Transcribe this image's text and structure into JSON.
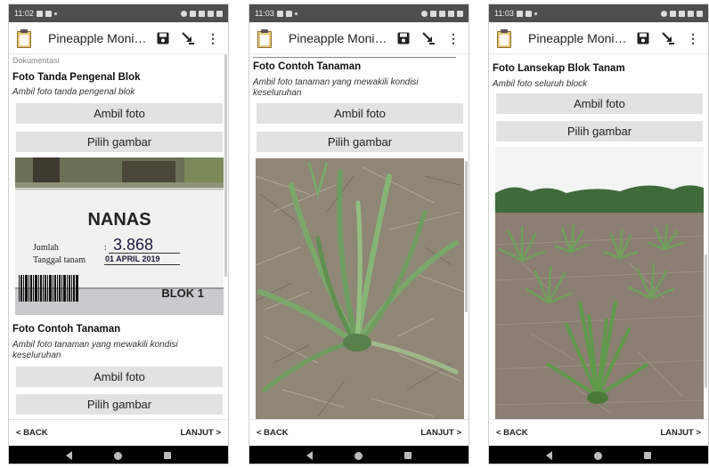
{
  "app": {
    "title": "Pineapple Monito...",
    "icons": {
      "app": "clipboard-icon",
      "save": "save-icon",
      "goto": "jump-arrow-icon",
      "menu": "overflow-menu-icon"
    },
    "accent": "#e2e2e2"
  },
  "screens": [
    {
      "status_time": "11:02",
      "section": "Dokumentasi",
      "questions": [
        {
          "title": "Foto Tanda Pengenal Blok",
          "hint": "Ambil foto tanda pengenal blok",
          "take_photo": "Ambil foto",
          "choose_image": "Pilih gambar",
          "sign": {
            "heading": "NANAS",
            "row1_label": "Jumlah",
            "row1_value": "3.868",
            "row2_label": "Tanggal tanam",
            "row2_value": "01 APRIL 2019",
            "block": "BLOK 1"
          }
        },
        {
          "title": "Foto Contoh Tanaman",
          "hint": "Ambil foto tanaman yang mewakili kondisi keseluruhan",
          "take_photo": "Ambil foto",
          "choose_image": "Pilih gambar"
        }
      ],
      "back": "< BACK",
      "next": "LANJUT >"
    },
    {
      "status_time": "11:03",
      "questions": [
        {
          "title": "Foto Contoh Tanaman",
          "hint": "Ambil foto tanaman yang mewakili kondisi keseluruhan",
          "take_photo": "Ambil foto",
          "choose_image": "Pilih gambar"
        }
      ],
      "back": "< BACK",
      "next": "LANJUT >"
    },
    {
      "status_time": "11:03",
      "questions": [
        {
          "title": "Foto Lansekap Blok Tanam",
          "hint": "Ambil foto seluruh block",
          "take_photo": "Ambil foto",
          "choose_image": "Pilih gambar"
        }
      ],
      "back": "< BACK",
      "next": "LANJUT >"
    }
  ]
}
